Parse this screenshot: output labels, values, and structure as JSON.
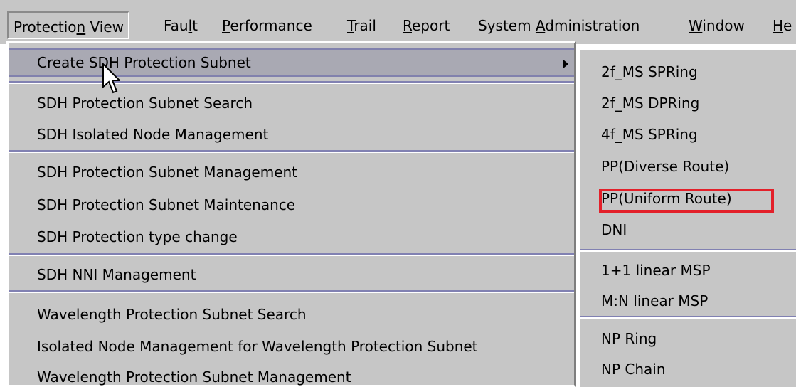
{
  "menubar": {
    "items": [
      {
        "pre": "Protectio",
        "acc": "n",
        "post": " View"
      },
      {
        "pre": "Fau",
        "acc": "l",
        "post": "t"
      },
      {
        "pre": "",
        "acc": "P",
        "post": "erformance"
      },
      {
        "pre": "",
        "acc": "T",
        "post": "rail"
      },
      {
        "pre": "",
        "acc": "R",
        "post": "eport"
      },
      {
        "pre": "System ",
        "acc": "A",
        "post": "dministration"
      },
      {
        "pre": "",
        "acc": "W",
        "post": "indow"
      },
      {
        "pre": "",
        "acc": "H",
        "post": "e"
      }
    ]
  },
  "main_menu": {
    "items": [
      {
        "label": "Create SDH Protection Subnet"
      },
      {
        "label": "SDH Protection Subnet Search"
      },
      {
        "label": "SDH Isolated Node Management"
      },
      {
        "label": "SDH Protection Subnet Management"
      },
      {
        "label": "SDH Protection Subnet Maintenance"
      },
      {
        "label": "SDH Protection type change"
      },
      {
        "label": "SDH NNI Management"
      },
      {
        "label": "Wavelength Protection Subnet Search"
      },
      {
        "label": "Isolated Node Management for Wavelength Protection Subnet"
      },
      {
        "label": "Wavelength Protection Subnet Management"
      }
    ]
  },
  "sub_menu": {
    "items": [
      {
        "label": "2f_MS SPRing"
      },
      {
        "label": "2f_MS DPRing"
      },
      {
        "label": "4f_MS SPRing"
      },
      {
        "label": "PP(Diverse Route)"
      },
      {
        "label": "PP(Uniform Route)"
      },
      {
        "label": "DNI"
      },
      {
        "label": "1+1 linear MSP"
      },
      {
        "label": "M:N linear MSP"
      },
      {
        "label": "NP Ring"
      },
      {
        "label": "NP Chain"
      }
    ]
  },
  "icons": {
    "submenu_arrow": "arrow-right-icon",
    "cursor": "mouse-pointer-icon"
  },
  "colors": {
    "menu_background": "#c6c6c6",
    "highlight": "#a9a9b3",
    "separator": "#8181b2",
    "annotation": "#e3202a"
  }
}
